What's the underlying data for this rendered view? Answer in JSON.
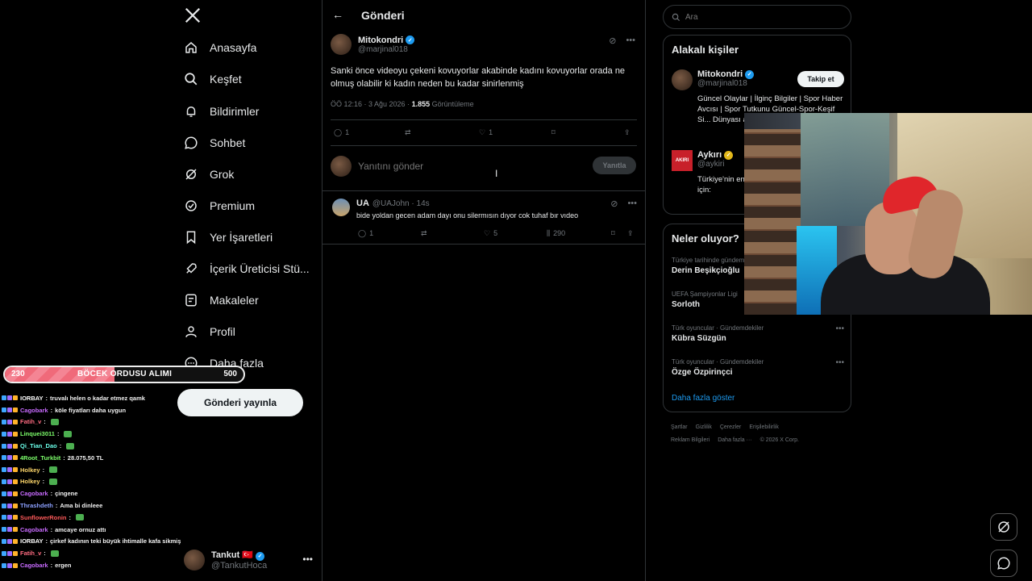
{
  "nav": {
    "logo": "X",
    "items": [
      {
        "label": "Anasayfa",
        "icon": "home-icon"
      },
      {
        "label": "Keşfet",
        "icon": "search-icon"
      },
      {
        "label": "Bildirimler",
        "icon": "bell-icon"
      },
      {
        "label": "Sohbet",
        "icon": "chat-icon"
      },
      {
        "label": "Grok",
        "icon": "grok-icon"
      },
      {
        "label": "Premium",
        "icon": "premium-icon"
      },
      {
        "label": "Yer İşaretleri",
        "icon": "bookmark-icon"
      },
      {
        "label": "İçerik Üreticisi Stü...",
        "icon": "rocket-icon"
      },
      {
        "label": "Makaleler",
        "icon": "article-icon"
      },
      {
        "label": "Profil",
        "icon": "person-icon"
      },
      {
        "label": "Daha fazla",
        "icon": "more-circle-icon"
      }
    ],
    "post_button": "Gönderi yayınla",
    "profile": {
      "name": "Tankut",
      "handle": "@TankutHoca",
      "flag": "🇹🇷"
    }
  },
  "overlay": {
    "progress": {
      "current": "230",
      "goal": "500",
      "label": "BÖCEK ORDUSU ALIMI",
      "fraction": 0.46
    },
    "chat": [
      {
        "user": "IORBAY",
        "color": "#ffffff",
        "msg": "truvalı helen o kadar etmez qamk"
      },
      {
        "user": "Cagobark",
        "color": "#c86bff",
        "msg": "köle fiyatları daha uygun"
      },
      {
        "user": "Fatih_v",
        "color": "#ff6b81",
        "msg": ""
      },
      {
        "user": "Linquei3011",
        "color": "#7dff6b",
        "msg": ""
      },
      {
        "user": "Qi_Tian_Dao",
        "color": "#6bffea",
        "msg": ""
      },
      {
        "user": "4Root_Turkbit",
        "color": "#7dff6b",
        "msg": "28.075,50 TL"
      },
      {
        "user": "Holkey",
        "color": "#ffd86b",
        "msg": ""
      },
      {
        "user": "Holkey",
        "color": "#ffd86b",
        "msg": ""
      },
      {
        "user": "Cagobark",
        "color": "#c86bff",
        "msg": "çingene"
      },
      {
        "user": "Thrashdeth",
        "color": "#8ca0ff",
        "msg": "Ama bi dinleee"
      },
      {
        "user": "SunflowerRonin",
        "color": "#ff5a5a",
        "msg": ""
      },
      {
        "user": "Cagobark",
        "color": "#c86bff",
        "msg": "amcaye ornuz attı"
      },
      {
        "user": "IORBAY",
        "color": "#ffffff",
        "msg": "çirkef kadının teki büyük ihtimalle kafa sikmiştir"
      },
      {
        "user": "Fatih_v",
        "color": "#ff6b81",
        "msg": ""
      },
      {
        "user": "Cagobark",
        "color": "#c86bff",
        "msg": "ergen"
      }
    ]
  },
  "main": {
    "header": "Gönderi",
    "tweet": {
      "name": "Mitokondri",
      "handle": "@marjinal018",
      "text": "Sanki önce videoyu çekeni kovuyorlar akabinde kadını kovuyorlar orada ne olmuş olabilir ki kadın neden bu kadar sinirlenmiş",
      "time": "ÖÖ 12:16 · 3 Ağu 2026 · ",
      "views": "1.855",
      "views_label": " Görüntüleme",
      "replies": "1",
      "likes": "1"
    },
    "reply_placeholder": "Yanıtını gönder",
    "reply_button": "Yanıtla",
    "reply": {
      "name": "UA",
      "handle": "@UAJohn · 14s",
      "text": "bide yoldan gecen adam dayı onu silermısın dıyor cok tuhaf bır vıdeo",
      "replies": "1",
      "likes": "5",
      "views": "290"
    }
  },
  "right": {
    "search_placeholder": "Ara",
    "relevant_title": "Alakalı kişiler",
    "people": [
      {
        "name": "Mitokondri",
        "handle": "@marjinal018",
        "bio": "Güncel Olaylar | İlginç Bilgiler | Spor Haber Avcısı | Spor Tutkunu Güncel-Spor-Keşif Si... Dünyası ana h...",
        "follow": "Takip et"
      },
      {
        "name": "Aykırı",
        "handle": "@aykiri",
        "bio": "Türkiye'nin en... platformu Ha... birlikleri için:",
        "logo_text": "AKIRI"
      }
    ],
    "trends_title": "Neler oluyor?",
    "trends": [
      {
        "context": "Türkiye tarihinde gündem",
        "title": "Derin Beşikçioğlu"
      },
      {
        "context": "UEFA Şampiyonlar Ligi",
        "title": "Sorloth"
      },
      {
        "context": "Türk oyuncular · Gündemdekiler",
        "title": "Kübra Süzgün"
      },
      {
        "context": "Türk oyuncular · Gündemdekiler",
        "title": "Özge Özpirinçci"
      }
    ],
    "show_more": "Daha fazla göster",
    "footer_row1": [
      "Şartlar",
      "Gizlilik",
      "Çerezler",
      "Erişilebilirlik"
    ],
    "footer_row2": [
      "Reklam Bilgileri",
      "Daha fazla ···",
      "© 2026 X Corp."
    ]
  },
  "colors": {
    "accent": "#1d9bf0",
    "verified": "#1d9bf0",
    "gold": "#e2b719",
    "border": "#2f3336"
  }
}
